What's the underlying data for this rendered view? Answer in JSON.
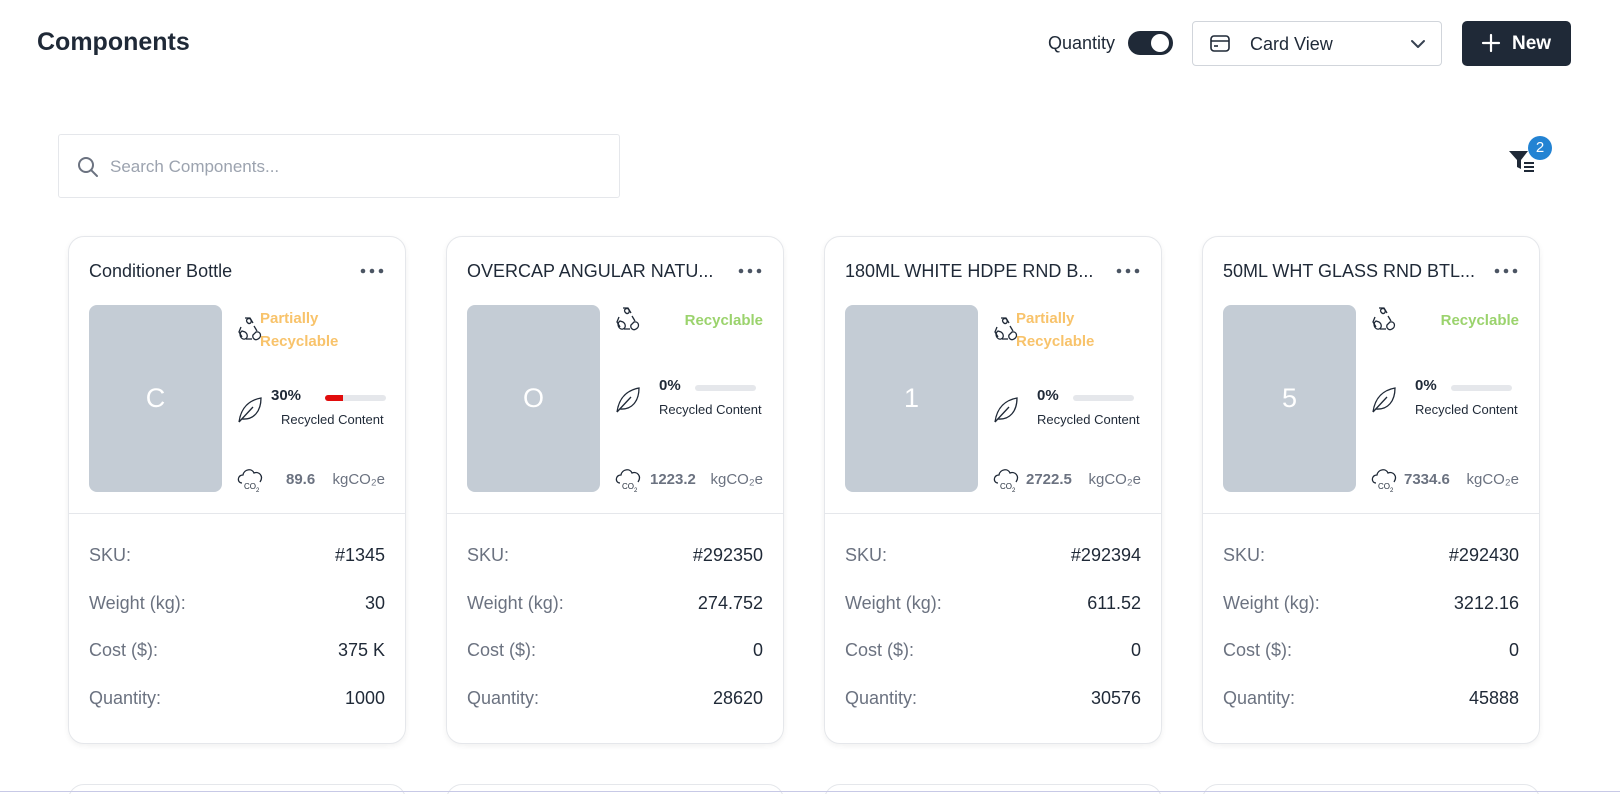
{
  "header": {
    "title": "Components",
    "quantity_label": "Quantity",
    "quantity_toggle_on": true,
    "view_select": {
      "value": "Card View"
    },
    "new_button_label": "New"
  },
  "search": {
    "placeholder": "Search Components...",
    "value": ""
  },
  "filter": {
    "badge_count": "2"
  },
  "cards": [
    {
      "title": "Conditioner Bottle",
      "initial": "C",
      "recyclability": "Partially Recyclable",
      "recyclability_status": "partial",
      "recycled_pct": "30%",
      "recycled_fraction": 0.3,
      "recycled_label": "Recycled Content",
      "co2_value": "89.6",
      "co2_unit": "kgCO₂e",
      "fields": [
        {
          "label": "SKU:",
          "value": "#1345"
        },
        {
          "label": "Weight (kg):",
          "value": "30"
        },
        {
          "label": "Cost ($):",
          "value": "375 K"
        },
        {
          "label": "Quantity:",
          "value": "1000"
        }
      ]
    },
    {
      "title": "OVERCAP ANGULAR NATU...",
      "initial": "O",
      "recyclability": "Recyclable",
      "recyclability_status": "full",
      "recycled_pct": "0%",
      "recycled_fraction": 0,
      "recycled_label": "Recycled Content",
      "co2_value": "1223.2",
      "co2_unit": "kgCO₂e",
      "fields": [
        {
          "label": "SKU:",
          "value": "#292350"
        },
        {
          "label": "Weight (kg):",
          "value": "274.752"
        },
        {
          "label": "Cost ($):",
          "value": "0"
        },
        {
          "label": "Quantity:",
          "value": "28620"
        }
      ]
    },
    {
      "title": "180ML WHITE HDPE RND B...",
      "initial": "1",
      "recyclability": "Partially Recyclable",
      "recyclability_status": "partial",
      "recycled_pct": "0%",
      "recycled_fraction": 0,
      "recycled_label": "Recycled Content",
      "co2_value": "2722.5",
      "co2_unit": "kgCO₂e",
      "fields": [
        {
          "label": "SKU:",
          "value": "#292394"
        },
        {
          "label": "Weight (kg):",
          "value": "611.52"
        },
        {
          "label": "Cost ($):",
          "value": "0"
        },
        {
          "label": "Quantity:",
          "value": "30576"
        }
      ]
    },
    {
      "title": "50ML WHT GLASS RND BTL...",
      "initial": "5",
      "recyclability": "Recyclable",
      "recyclability_status": "full",
      "recycled_pct": "0%",
      "recycled_fraction": 0,
      "recycled_label": "Recycled Content",
      "co2_value": "7334.6",
      "co2_unit": "kgCO₂e",
      "fields": [
        {
          "label": "SKU:",
          "value": "#292430"
        },
        {
          "label": "Weight (kg):",
          "value": "3212.16"
        },
        {
          "label": "Cost ($):",
          "value": "0"
        },
        {
          "label": "Quantity:",
          "value": "45888"
        }
      ]
    }
  ],
  "colors": {
    "primary": "#1f2937",
    "partial": "#f8c36b",
    "recyclable": "#9bd36d",
    "progress_fill": "#e10c0c",
    "badge": "#2383d3",
    "thumbnail": "#c4ccd5"
  },
  "icons": [
    "card-view-icon",
    "chevron-down-icon",
    "plus-icon",
    "search-icon",
    "filter-icon",
    "more-dots-icon",
    "recycle-icon",
    "leaf-icon",
    "co2-cloud-icon"
  ]
}
